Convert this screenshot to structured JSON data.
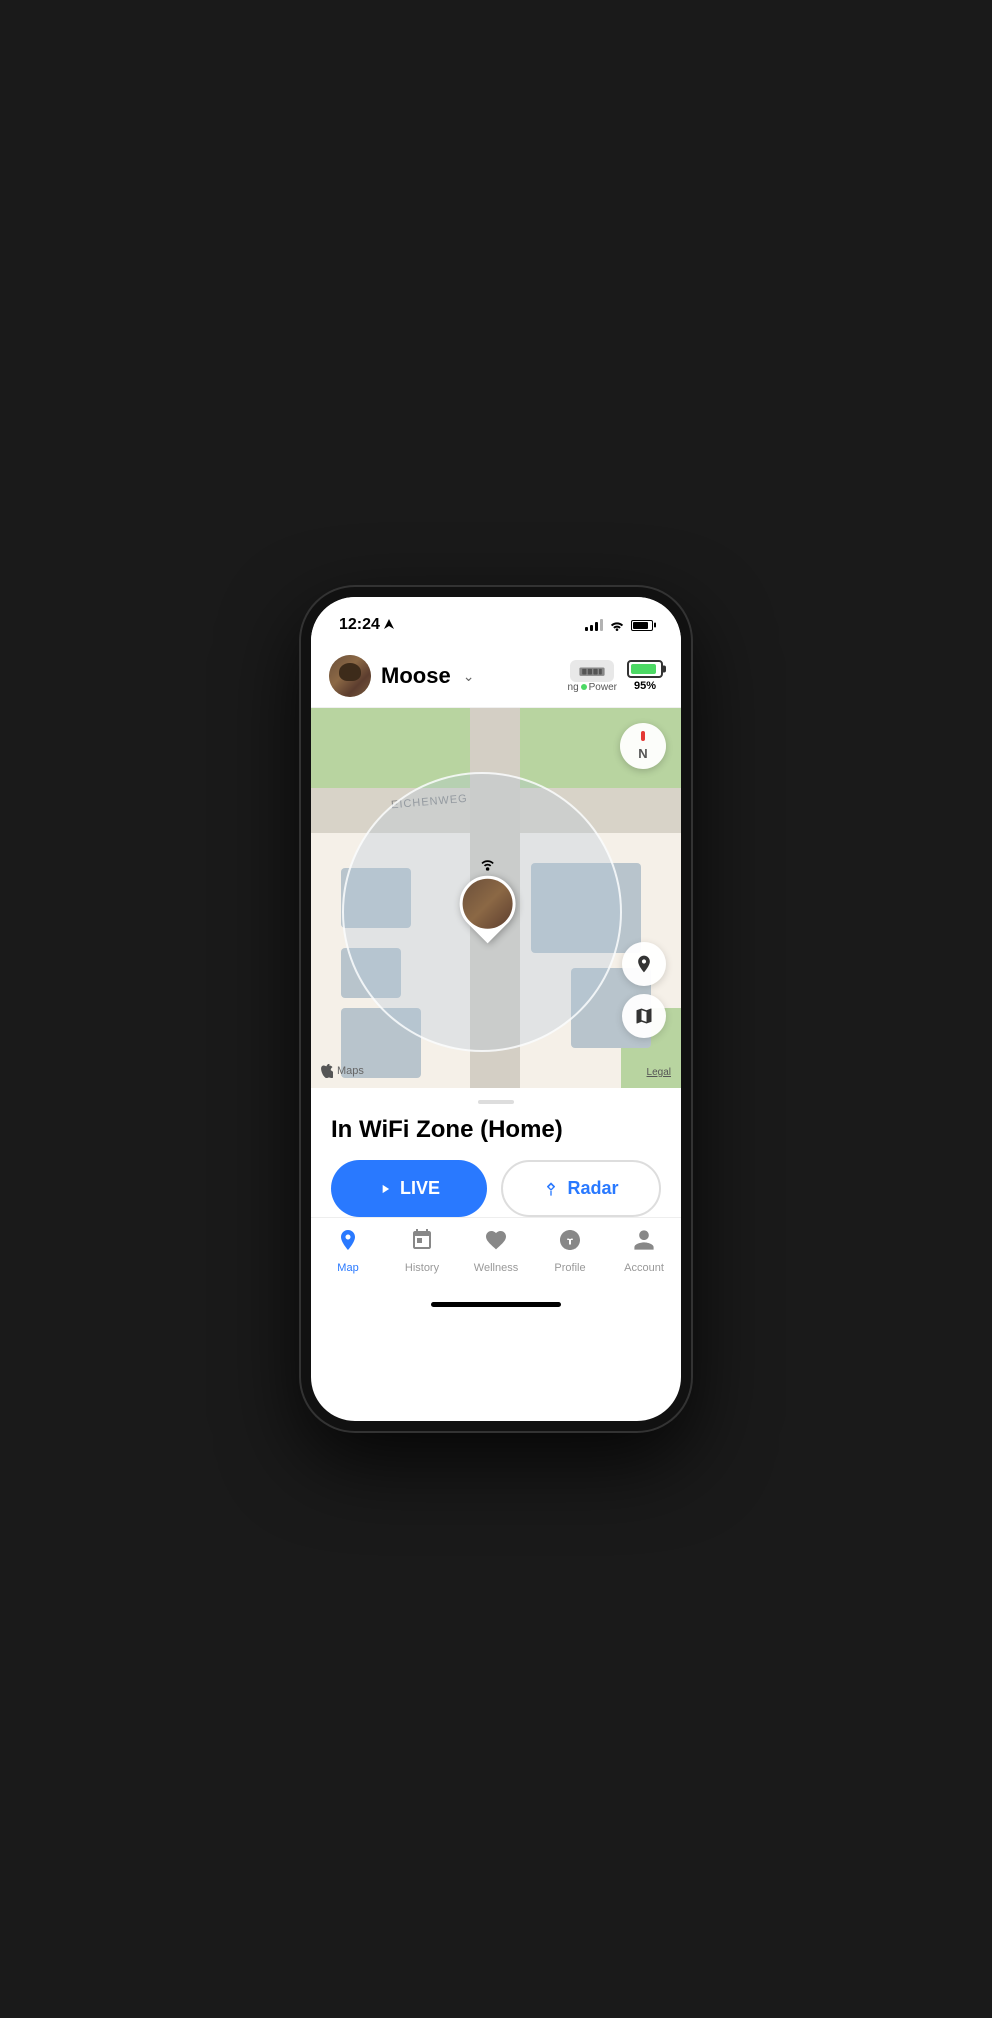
{
  "statusBar": {
    "time": "12:24",
    "locationArrow": "▶"
  },
  "header": {
    "petName": "Moose",
    "chevron": "∨",
    "deviceLabel": "Charging",
    "powerLabel": "Power",
    "batteryPercent": "95%"
  },
  "map": {
    "streetName": "EICHENWEG",
    "compassLabel": "N",
    "legalLabel": "Legal",
    "appleMapsBrand": "Maps"
  },
  "panel": {
    "locationStatus": "In WiFi Zone (Home)",
    "liveBtnLabel": "LIVE",
    "radarBtnLabel": "Radar"
  },
  "nav": {
    "items": [
      {
        "id": "map",
        "label": "Map",
        "active": true
      },
      {
        "id": "history",
        "label": "History",
        "active": false
      },
      {
        "id": "wellness",
        "label": "Wellness",
        "active": false
      },
      {
        "id": "profile",
        "label": "Profile",
        "active": false
      },
      {
        "id": "account",
        "label": "Account",
        "active": false
      }
    ]
  }
}
